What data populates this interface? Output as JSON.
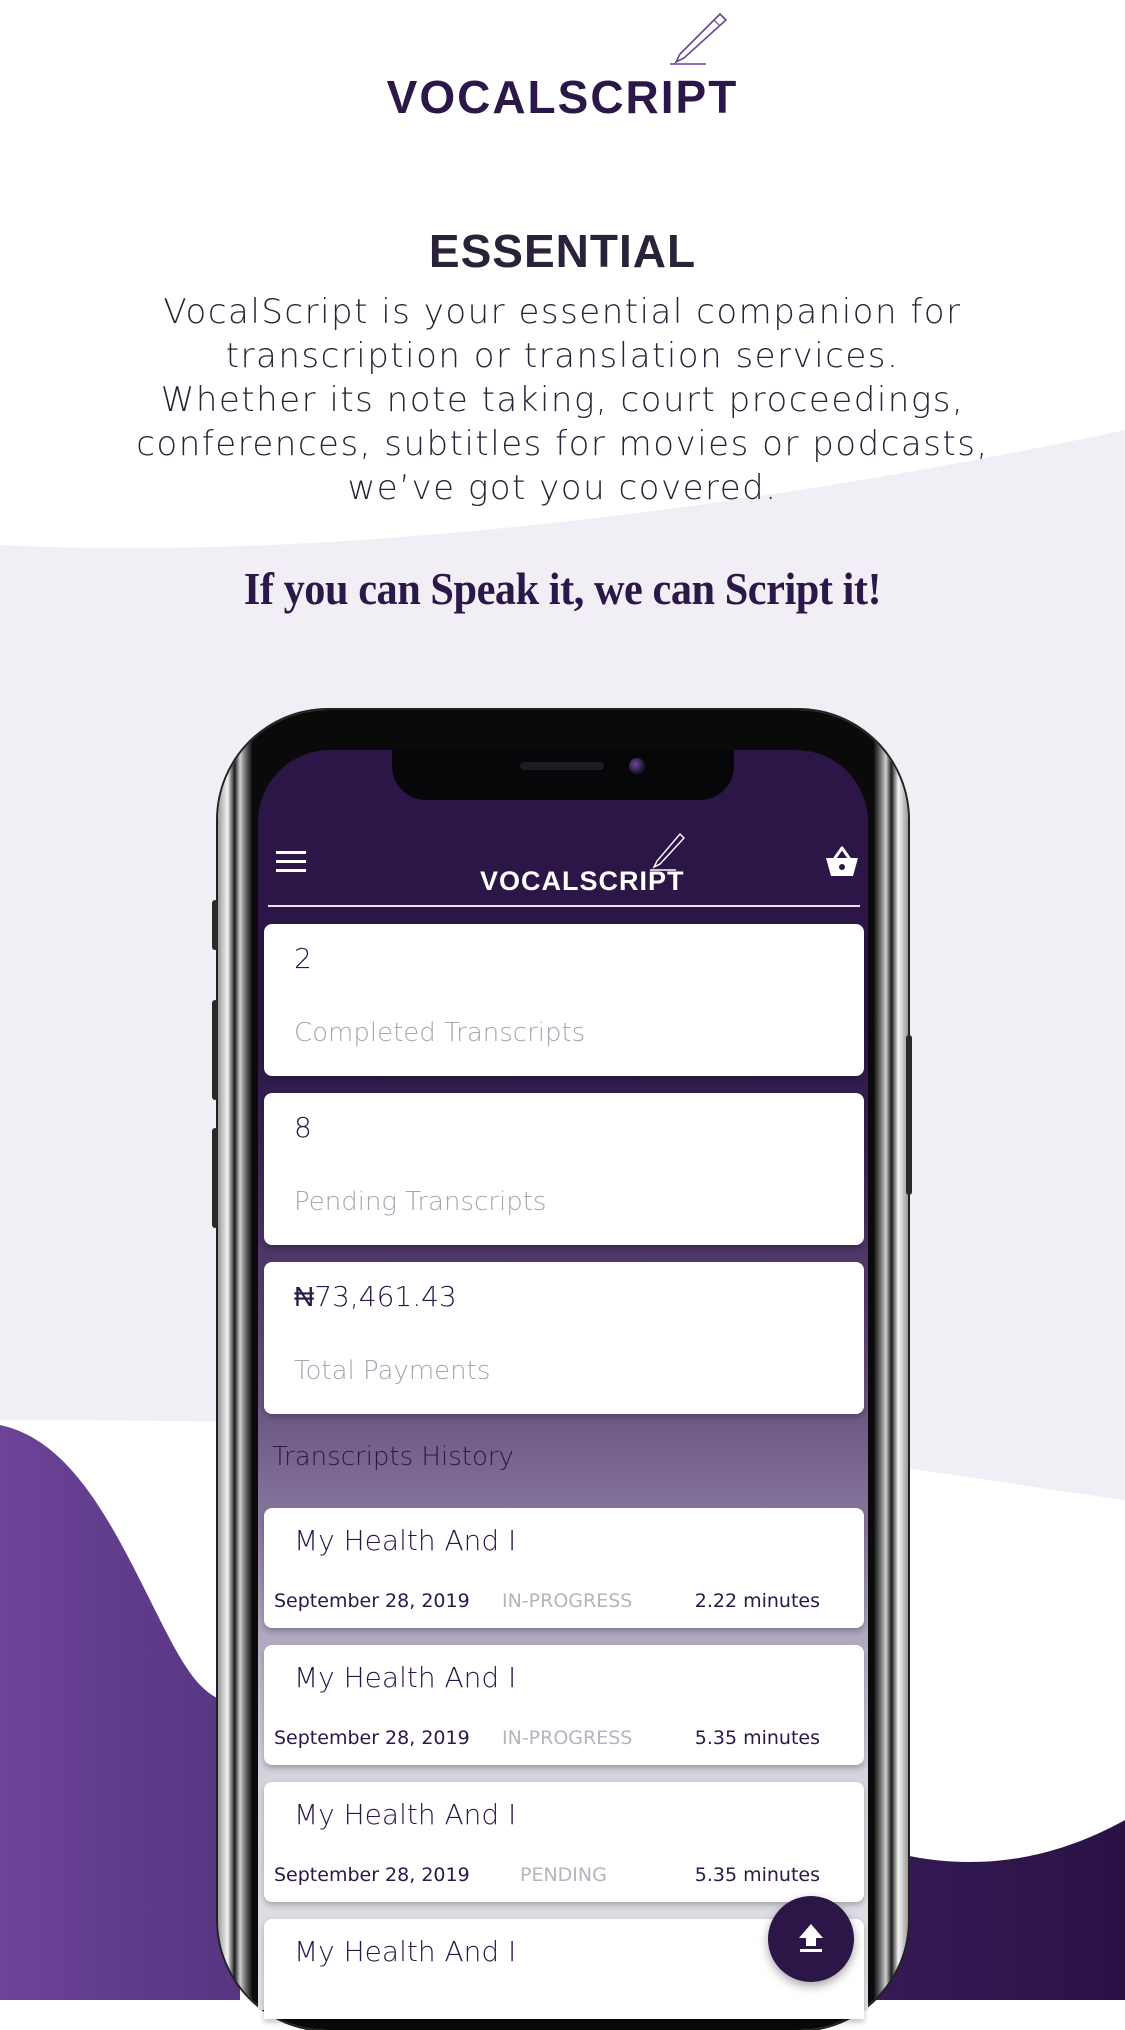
{
  "brand": {
    "name": "VOCALSCRIPT",
    "colors": {
      "primary": "#2b1748",
      "accent_purple": "#6a4296",
      "light_bg": "#f1eff5",
      "card_label": "#a9a3b2",
      "status_muted": "#b9b2bf"
    }
  },
  "hero": {
    "heading": "ESSENTIAL",
    "intro_lines": [
      "VocalScript is your essential companion for",
      "transcription or translation services.",
      "Whether its note taking, court proceedings,",
      "conferences, subtitles for movies or podcasts,",
      "we’ve got you covered."
    ],
    "tagline": "If you can Speak it, we can Script it!"
  },
  "app": {
    "header": {
      "logo_text": "VOCALSCRIPT",
      "menu_icon": "hamburger-menu-icon",
      "cart_icon": "basket-icon"
    },
    "stats": [
      {
        "value": "2",
        "label": "Completed Transcripts"
      },
      {
        "value": "8",
        "label": "Pending Transcripts"
      },
      {
        "value": "₦73,461.43",
        "label": "Total Payments"
      }
    ],
    "history_title": "Transcripts History",
    "history": [
      {
        "title": "My Health And I",
        "date": "September 28, 2019",
        "status": "IN-PROGRESS",
        "duration": "2.22 minutes"
      },
      {
        "title": "My Health And I",
        "date": "September 28, 2019",
        "status": "IN-PROGRESS",
        "duration": "5.35 minutes"
      },
      {
        "title": "My Health And I",
        "date": "September 28, 2019",
        "status": "PENDING",
        "duration": "5.35 minutes"
      },
      {
        "title": "My Health And I"
      }
    ],
    "fab_icon": "upload-icon"
  }
}
